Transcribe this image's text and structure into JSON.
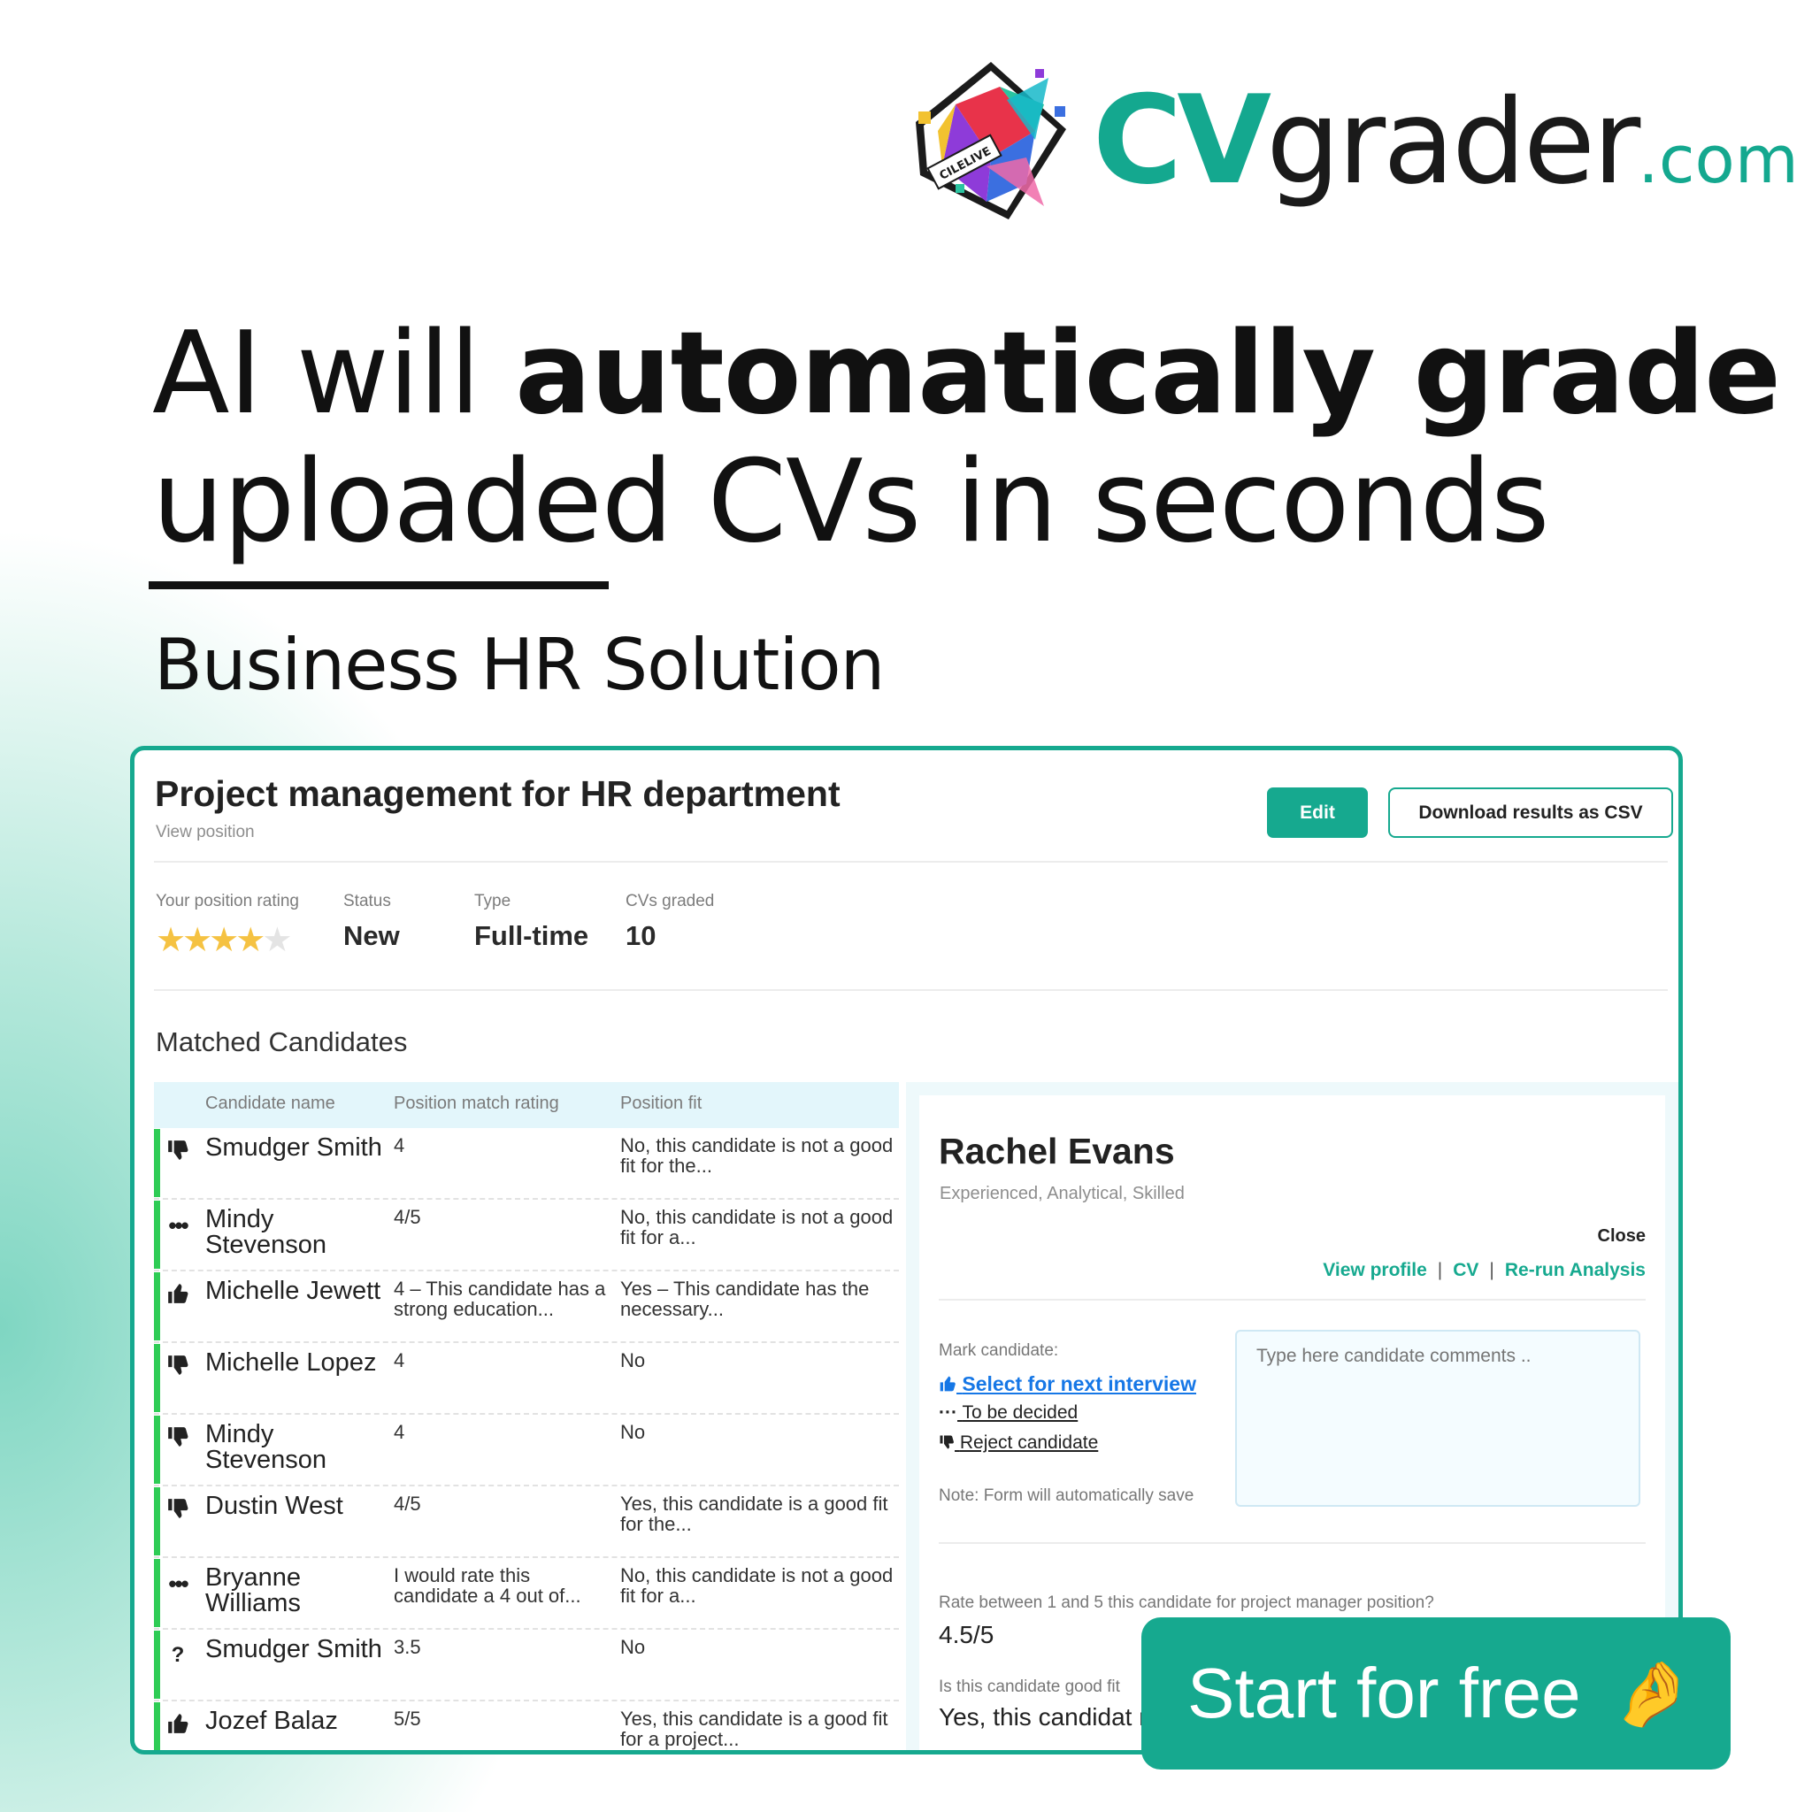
{
  "logo": {
    "cv": "CV",
    "grader": "grader",
    "com": ".com",
    "badge": "CILELIVE"
  },
  "headline": {
    "part1": "AI will ",
    "part2": "automatically grade",
    "line2": "uploaded CVs in seconds"
  },
  "subtitle": "Business HR Solution",
  "colors": {
    "brand": "#16a98f",
    "positive_bar": "#2ecc55",
    "link_blue": "#1677e6",
    "star": "#f5c242"
  },
  "position": {
    "title": "Project management for HR department",
    "view_link": "View position",
    "edit_label": "Edit",
    "download_label": "Download results as CSV",
    "meta": {
      "rating_label": "Your position rating",
      "rating": 4,
      "rating_max": 5,
      "status_label": "Status",
      "status": "New",
      "type_label": "Type",
      "type": "Full-time",
      "graded_label": "CVs graded",
      "graded": "10"
    }
  },
  "candidates": {
    "section_title": "Matched Candidates",
    "columns": [
      "Candidate name",
      "Position match rating",
      "Position fit"
    ],
    "rows": [
      {
        "icon": "thumbs-down-icon",
        "name": "Smudger Smith",
        "rating": "4",
        "fit": "No, this candidate is not a good fit for the..."
      },
      {
        "icon": "ellipsis-icon",
        "name": "Mindy Stevenson",
        "rating": "4/5",
        "fit": "No, this candidate is not a good fit for a..."
      },
      {
        "icon": "thumbs-up-icon",
        "name": "Michelle Jewett",
        "rating": "4 – This candidate has a strong education...",
        "fit": "Yes – This candidate has the necessary..."
      },
      {
        "icon": "thumbs-down-icon",
        "name": "Michelle Lopez",
        "rating": "4",
        "fit": "No"
      },
      {
        "icon": "thumbs-down-icon",
        "name": "Mindy Stevenson",
        "rating": "4",
        "fit": "No"
      },
      {
        "icon": "thumbs-down-icon",
        "name": "Dustin West",
        "rating": "4/5",
        "fit": "Yes, this candidate is a good fit for the..."
      },
      {
        "icon": "ellipsis-icon",
        "name": "Bryanne Williams",
        "rating": "I would rate this candidate a 4 out of...",
        "fit": "No, this candidate is not a good fit for a..."
      },
      {
        "icon": "question-icon",
        "name": "Smudger Smith",
        "rating": "3.5",
        "fit": "No"
      },
      {
        "icon": "thumbs-up-icon",
        "name": "Jozef Balaz",
        "rating": "5/5",
        "fit": "Yes, this candidate is a good fit for a project..."
      }
    ]
  },
  "detail": {
    "name": "Rachel Evans",
    "tags": "Experienced, Analytical, Skilled",
    "close_label": "Close",
    "links": [
      "View profile",
      "CV",
      "Re-run Analysis"
    ],
    "mark_label": "Mark candidate:",
    "mark_options": [
      "Select for next interview",
      "To be decided",
      "Reject candidate"
    ],
    "note": "Note: Form will automatically save",
    "comments_placeholder": "Type here candidate comments ..",
    "q1": "Rate between 1 and 5 this candidate for project manager position?",
    "a1": "4.5/5",
    "q2": "Is this candidate good fit",
    "a2": "Yes, this candidat manager."
  },
  "cta": {
    "label": "Start for free",
    "emoji": "🤌"
  }
}
